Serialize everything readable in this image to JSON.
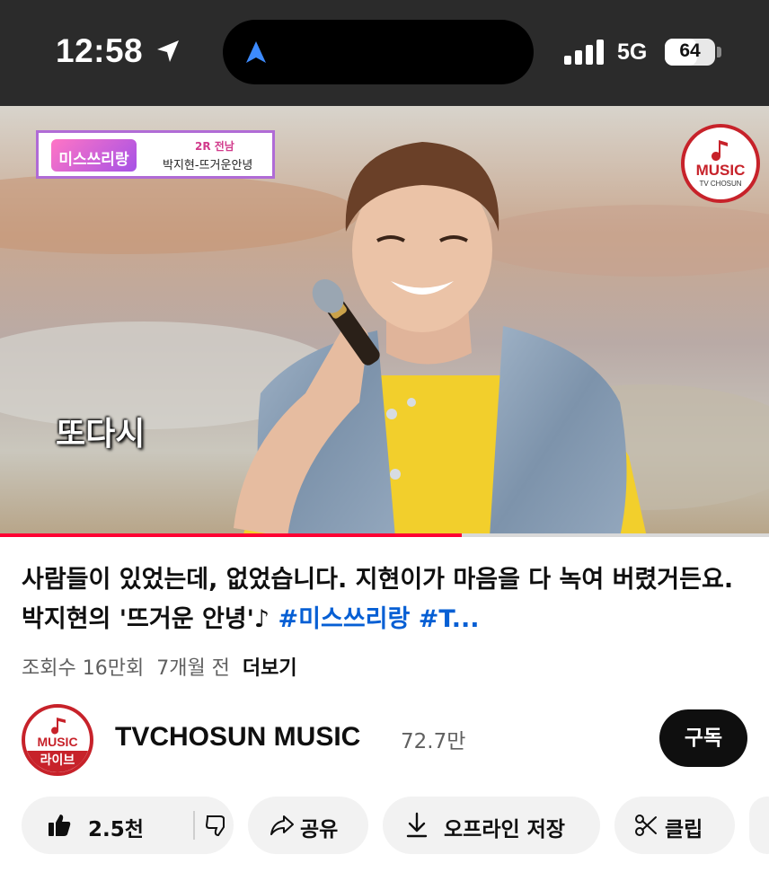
{
  "status_bar": {
    "time": "12:58",
    "network": "5G",
    "battery": "64",
    "battery_level": 0.64
  },
  "video": {
    "badge_show_name": "미스쓰리랑",
    "badge_round": "2R 전남",
    "badge_song": "박지현-뜨거운안녕",
    "channel_logo_text": "MUSIC",
    "channel_logo_sub": "TV CHOSUN",
    "caption": "또다시",
    "progress": 0.6
  },
  "title": {
    "text": "사람들이 있었는데, 없었습니다. 지현이가 마음을 다 녹여 버렸거든요. 박지현의 '뜨거운 안녕'♪ ",
    "hashtag1": "#미스쓰리랑",
    "hashtag2": "#T..."
  },
  "meta": {
    "views": "조회수 16만회",
    "age": "7개월 전",
    "more": "더보기"
  },
  "channel": {
    "name": "TVCHOSUN MUSIC",
    "subscribers": "72.7만",
    "avatar_top": "MUSIC",
    "avatar_bottom": "라이브",
    "subscribe_label": "구독"
  },
  "actions": {
    "like_count": "2.5천",
    "share_label": "공유",
    "download_label": "오프라인 저장",
    "clip_label": "클립"
  },
  "icons": [
    "location-arrow-icon",
    "nav-arrow-icon",
    "signal-icon",
    "battery-icon",
    "music-note-icon",
    "thumbs-up-icon",
    "thumbs-down-icon",
    "share-icon",
    "download-icon",
    "scissors-icon"
  ],
  "colors": {
    "accent_red": "#ff0033",
    "hashtag_blue": "#065fd4",
    "channel_red": "#c7222a",
    "chip_bg": "#f2f2f2"
  }
}
